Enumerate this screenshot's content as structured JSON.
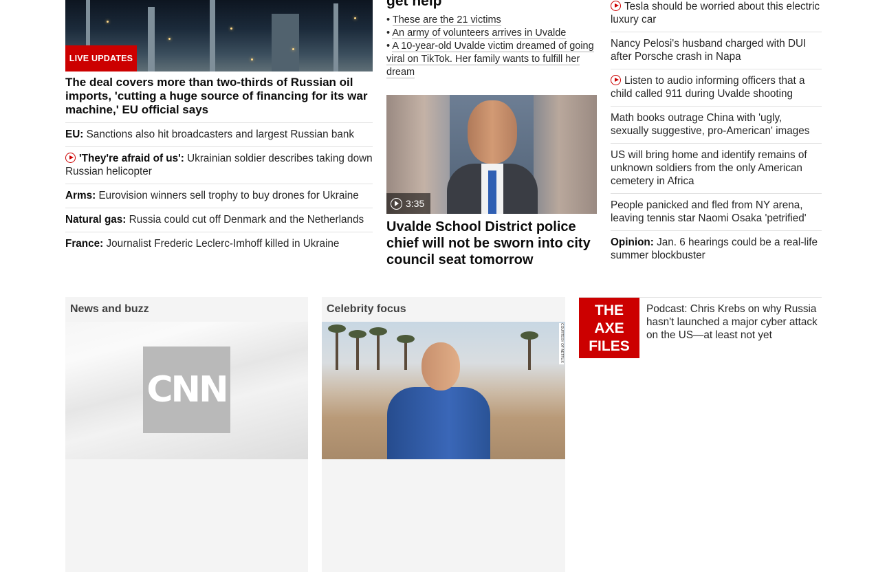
{
  "lead": {
    "badge": "LIVE UPDATES",
    "headline": "The deal covers more than two-thirds of Russian oil imports, 'cutting a huge source of financing for its war machine,' EU official says",
    "bullets": [
      {
        "label": "EU:",
        "text": " Sanctions also hit broadcasters and largest Russian bank",
        "video": false
      },
      {
        "label": "'They're afraid of us':",
        "text": " Ukrainian soldier describes taking down Russian helicopter",
        "video": true
      },
      {
        "label": "Arms:",
        "text": " Eurovision winners sell trophy to buy drones for Ukraine",
        "video": false
      },
      {
        "label": "Natural gas:",
        "text": " Russia could cut off Denmark and the Netherlands",
        "video": false
      },
      {
        "label": "France:",
        "text": " Journalist Frederic Leclerc-Imhoff killed in Ukraine",
        "video": false
      }
    ]
  },
  "middle": {
    "top_title": "get help",
    "links": [
      "These are the 21 victims",
      "An army of volunteers arrives in Uvalde",
      "A 10-year-old Uvalde victim dreamed of going viral on TikTok. Her family wants to fulfill her dream"
    ],
    "video_duration": "3:35",
    "headline": "Uvalde School District police chief will not be sworn into city council seat tomorrow"
  },
  "right": {
    "items": [
      {
        "label": "",
        "text": "Tesla should be worried about this electric luxury car",
        "video": true
      },
      {
        "label": "",
        "text": "Nancy Pelosi's husband charged with DUI after Porsche crash in Napa",
        "video": false
      },
      {
        "label": "",
        "text": "Listen to audio informing officers that a child called 911 during Uvalde shooting",
        "video": true
      },
      {
        "label": "",
        "text": "Math books outrage China with 'ugly, sexually suggestive, pro-American' images",
        "video": false
      },
      {
        "label": "",
        "text": "US will bring home and identify remains of unknown soldiers from the only American cemetery in Africa",
        "video": false
      },
      {
        "label": "",
        "text": "People panicked and fled from NY arena, leaving tennis star Naomi Osaka 'petrified'",
        "video": false
      },
      {
        "label": "Opinion:",
        "text": " Jan. 6 hearings could be a real-life summer blockbuster",
        "video": false
      }
    ]
  },
  "bottom": {
    "news_title": "News and buzz",
    "news_logo": "CNN",
    "celeb_title": "Celebrity focus",
    "celeb_credit": "COURTESY OF NETFLIX",
    "axe_logo": [
      "THE",
      "AXE",
      "FILES"
    ],
    "axe_text": "Podcast: Chris Krebs on why Russia hasn't launched a major cyber attack on the US—at least not yet"
  },
  "colors": {
    "accent": "#cc0000",
    "divider": "#e1e1e1",
    "zone_bg": "#f4f4f4"
  }
}
